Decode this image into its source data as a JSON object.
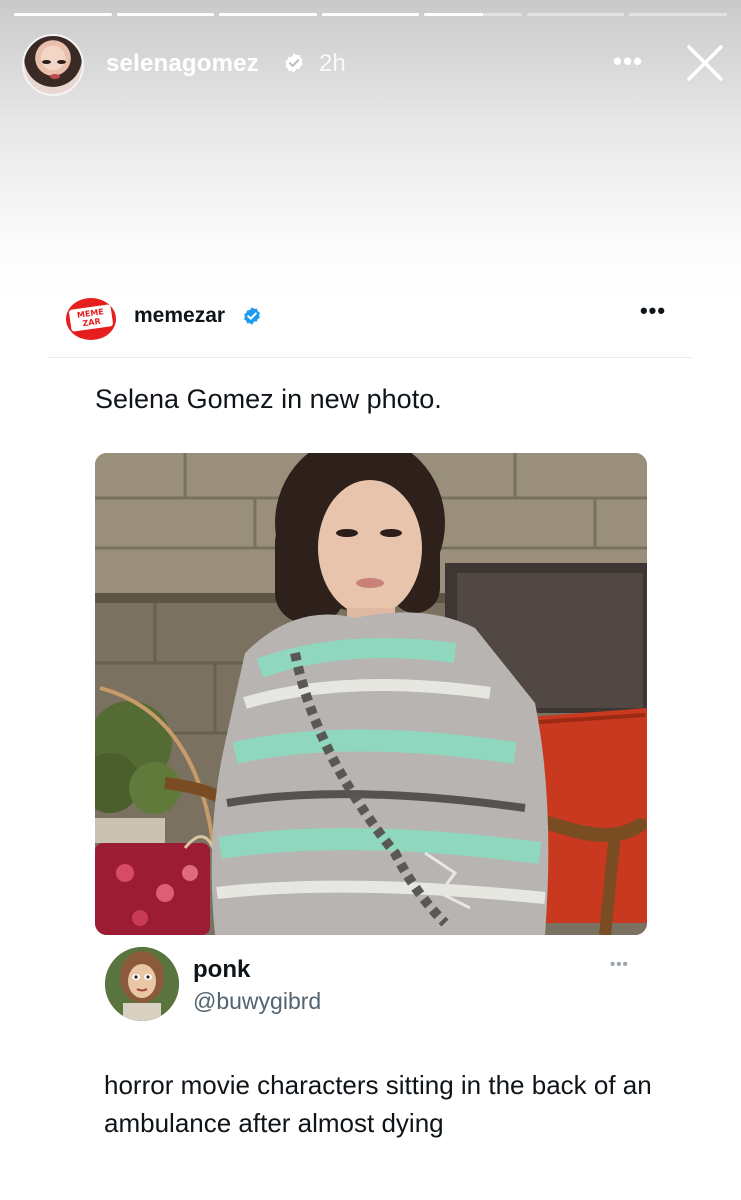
{
  "story": {
    "username": "selenagomez",
    "time": "2h",
    "more_label": "•••",
    "progress_segments": [
      1,
      1,
      1,
      1,
      0.6,
      0,
      0
    ]
  },
  "post": {
    "author": "memezar",
    "logo_text": "MEME ZAR",
    "more_label": "•••",
    "text": "Selena Gomez in new photo.",
    "quoted": {
      "name": "ponk",
      "handle": "@buwygibrd",
      "more_label": "•••",
      "text": "horror movie characters sitting in the back of an ambulance after almost dying"
    }
  },
  "colors": {
    "verified_blue": "#1d9bf0",
    "brand_red": "#e61e1e",
    "blanket_mint": "#8fd8bf",
    "chair_red": "#c8391f"
  }
}
